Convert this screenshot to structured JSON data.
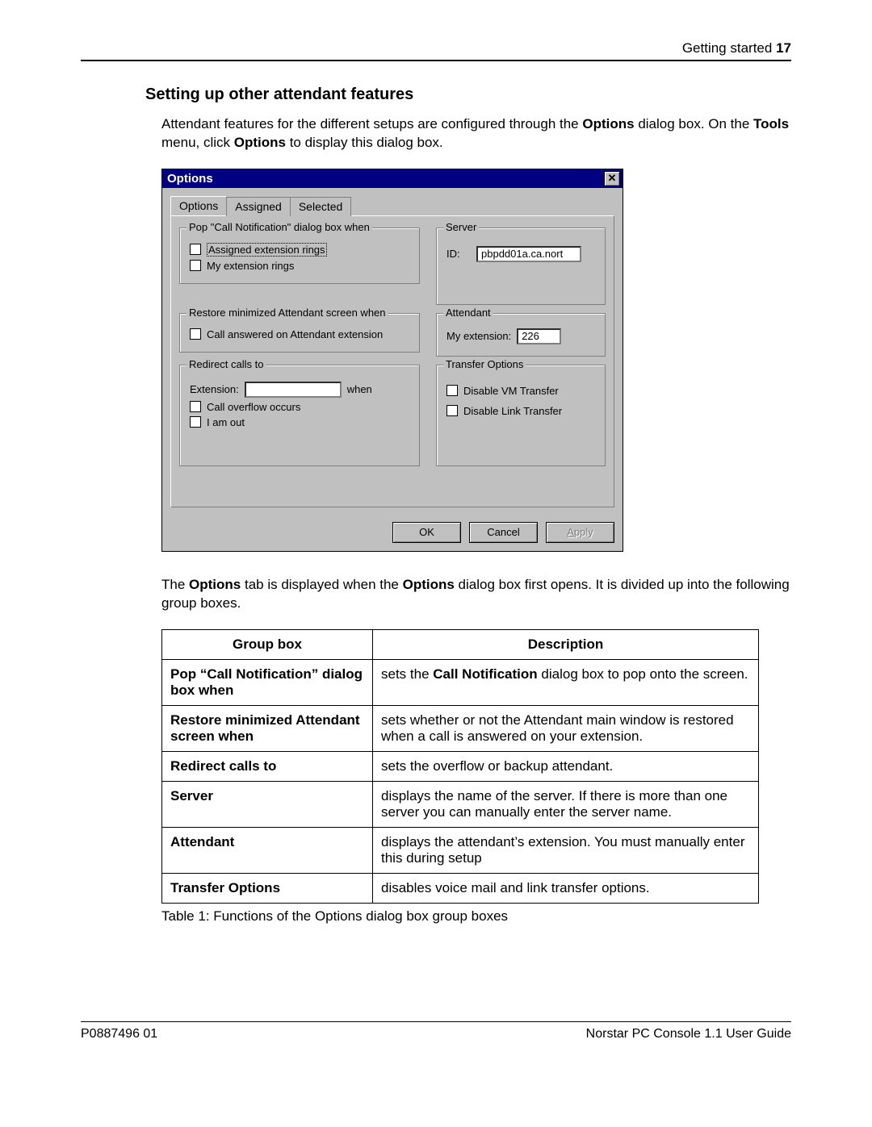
{
  "header": {
    "section": "Getting started",
    "page": "17"
  },
  "heading": "Setting up other attendant features",
  "intro": {
    "pre": "Attendant features for the different setups are configured through the ",
    "bold1": "Options",
    "mid1": " dialog box. On the ",
    "bold2": "Tools",
    "mid2": " menu, click ",
    "bold3": "Options",
    "post": " to display this dialog box."
  },
  "dialog": {
    "title": "Options",
    "tabs": [
      "Options",
      "Assigned",
      "Selected"
    ],
    "groups": {
      "pop": {
        "legend": "Pop \"Call Notification\" dialog box when",
        "opt1": "Assigned extension rings",
        "opt2": "My extension rings"
      },
      "restore": {
        "legend": "Restore minimized Attendant screen when",
        "opt1": "Call answered on Attendant extension"
      },
      "redirect": {
        "legend": "Redirect calls to",
        "ext_label": "Extension:",
        "when": "when",
        "opt1": "Call overflow occurs",
        "opt2": "I am out"
      },
      "server": {
        "legend": "Server",
        "id_label": "ID:",
        "id_value": "pbpdd01a.ca.nort"
      },
      "attendant": {
        "legend": "Attendant",
        "ext_label": "My extension:",
        "ext_value": "226"
      },
      "transfer": {
        "legend": "Transfer Options",
        "opt1": "Disable VM Transfer",
        "opt2": "Disable Link Transfer"
      }
    },
    "buttons": {
      "ok": "OK",
      "cancel": "Cancel",
      "apply": "Apply"
    }
  },
  "after": {
    "pre": "The ",
    "bold1": "Options",
    "mid1": " tab is displayed when the ",
    "bold2": "Options",
    "post": " dialog box first opens. It is divided up into the following group boxes."
  },
  "table": {
    "h1": "Group box",
    "h2": "Description",
    "rows": [
      {
        "name": "Pop “Call Notification” dialog box when",
        "pre": "sets the ",
        "bold": "Call Notification",
        "post": " dialog box to pop onto the screen."
      },
      {
        "name": "Restore minimized Attendant screen when",
        "desc": "sets whether or not the Attendant main window is restored when a call is answered on your extension."
      },
      {
        "name": "Redirect calls to",
        "desc": "sets the overflow or backup attendant."
      },
      {
        "name": "Server",
        "desc": "displays the name of the server. If there is more than one server you can manually enter the server name."
      },
      {
        "name": "Attendant",
        "desc": "displays the attendant’s extension. You must manually enter this during setup"
      },
      {
        "name": "Transfer Options",
        "desc": "disables voice mail and link transfer options."
      }
    ],
    "caption": "Table 1: Functions of the Options dialog box group boxes"
  },
  "footer": {
    "left": "P0887496 01",
    "right": "Norstar PC Console 1.1 User Guide"
  }
}
